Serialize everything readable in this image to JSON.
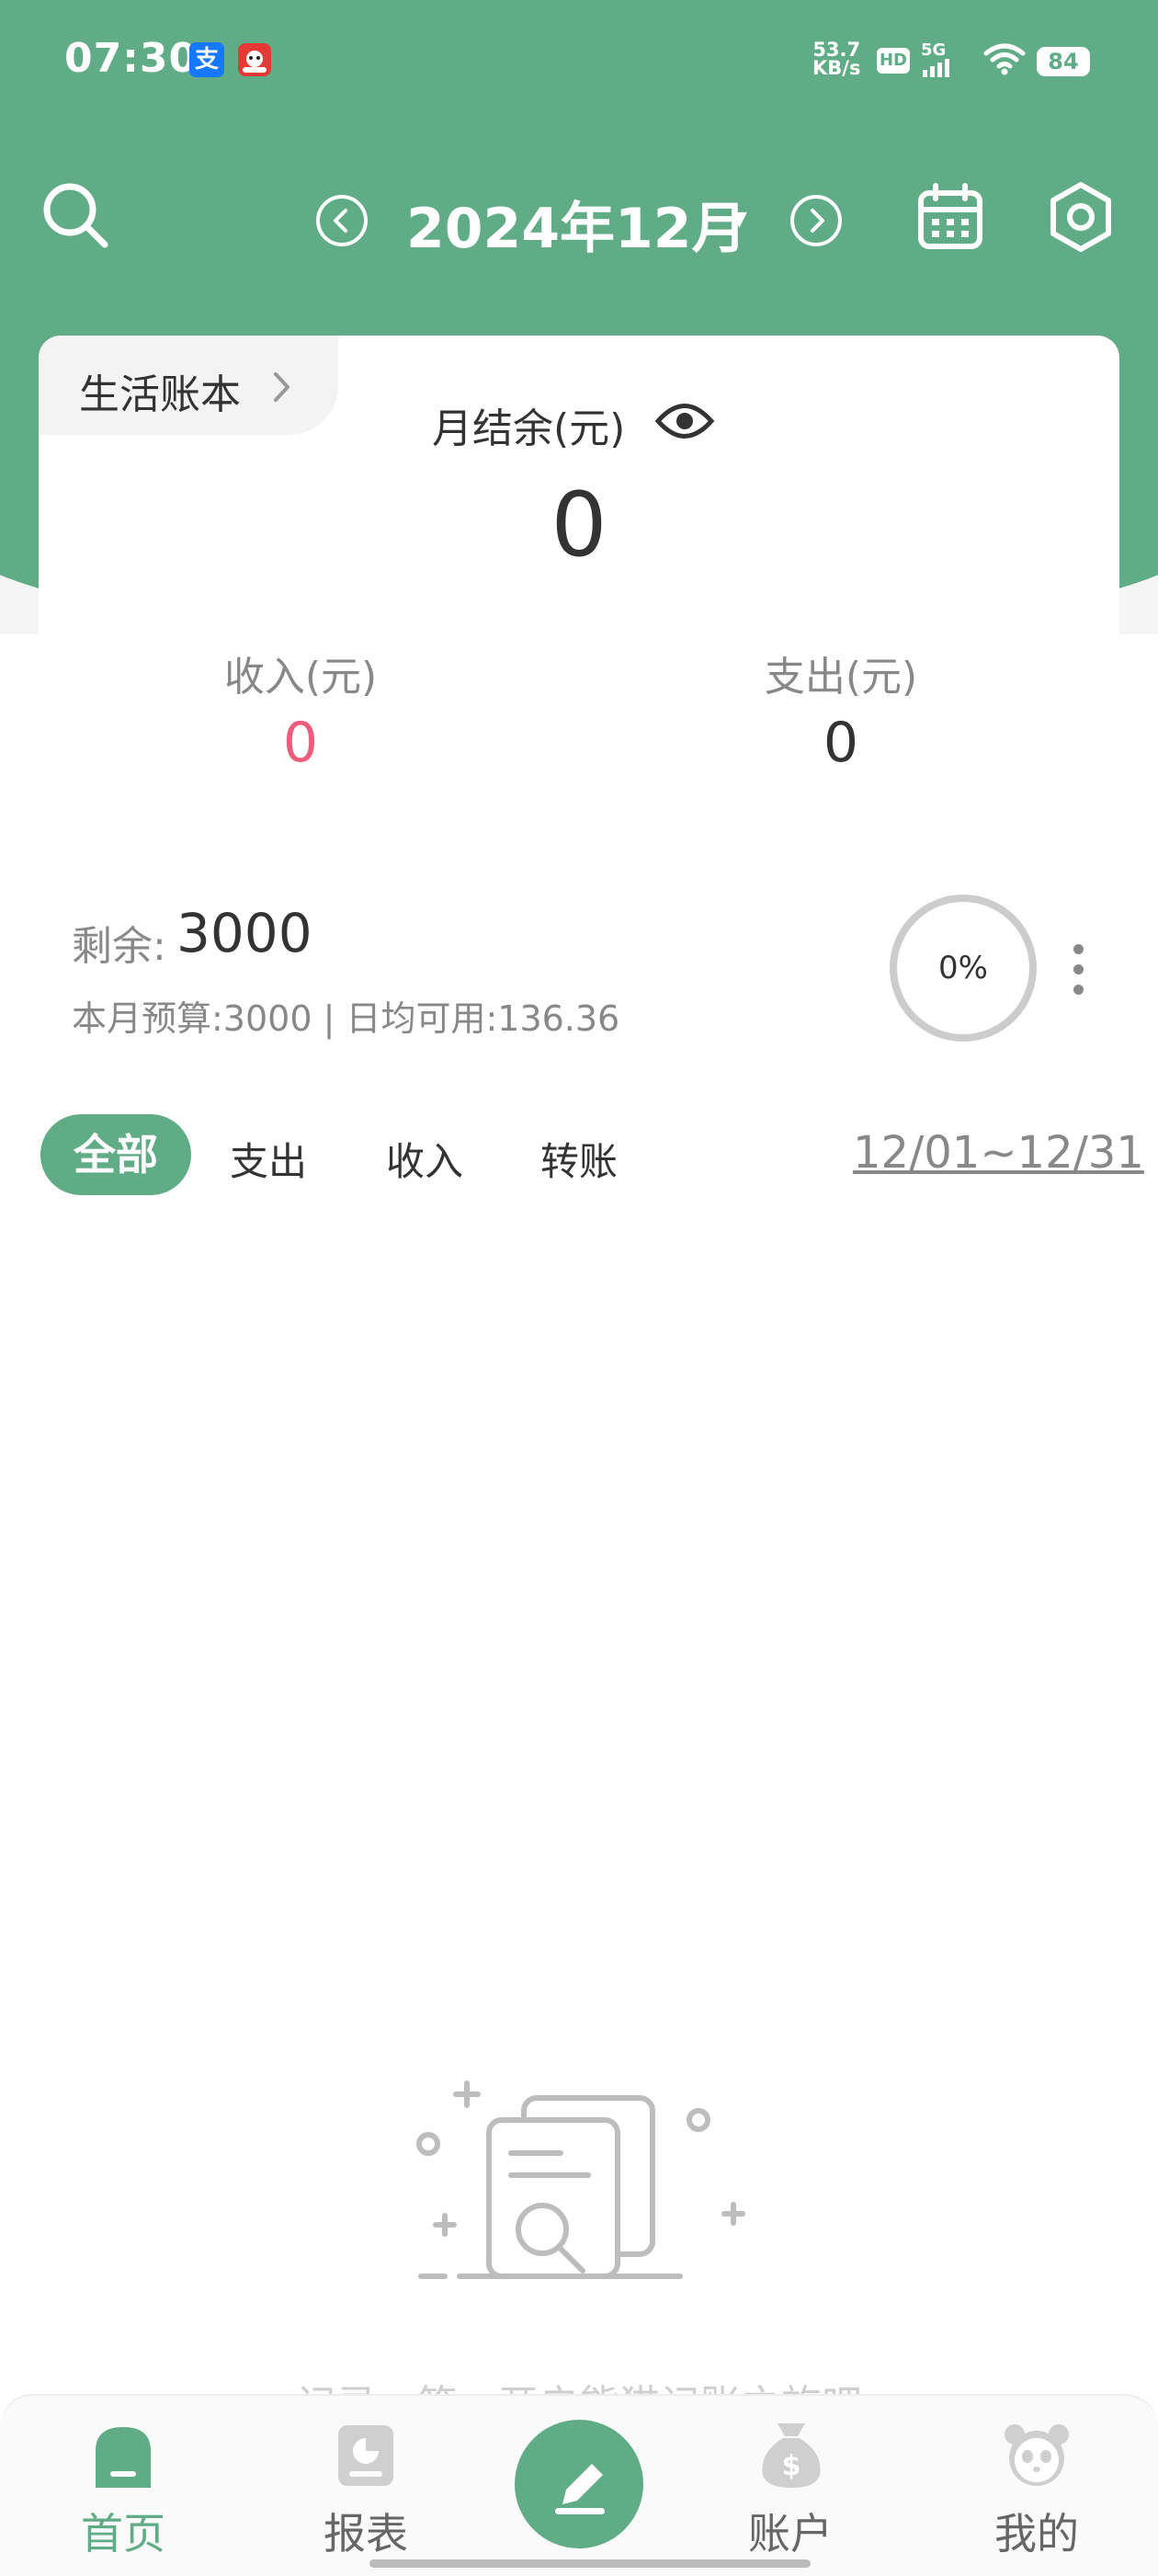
{
  "status_bar": {
    "time": "07:30",
    "app_icon_1": "支",
    "net_speed_value": "53.7",
    "net_speed_unit": "KB/s",
    "hd": "HD",
    "network": "5G",
    "battery": "84"
  },
  "header": {
    "month": "2024年12月"
  },
  "summary": {
    "book_name": "生活账本",
    "balance_label": "月结余(元)",
    "balance_value": "0",
    "income_label": "收入(元)",
    "income_value": "0",
    "expense_label": "支出(元)",
    "expense_value": "0"
  },
  "budget": {
    "remain_label": "剩余:",
    "remain_value": "3000",
    "meta": "本月预算:3000 | 日均可用:136.36",
    "percent": "0%"
  },
  "filters": {
    "tabs": [
      "全部",
      "支出",
      "收入",
      "转账"
    ],
    "date_range": "12/01~12/31"
  },
  "empty_state": {
    "hint": "记录一笔，开启熊猫记账之旅吧"
  },
  "bottom_nav": {
    "items": [
      {
        "label": "首页",
        "icon": "home-icon"
      },
      {
        "label": "报表",
        "icon": "report-icon"
      },
      {
        "label": "",
        "icon": "compose-icon"
      },
      {
        "label": "账户",
        "icon": "money-bag-icon"
      },
      {
        "label": "我的",
        "icon": "panda-icon"
      }
    ]
  },
  "colors": {
    "brand_green": "#5fac86",
    "income_pink": "#ef5b7a"
  }
}
